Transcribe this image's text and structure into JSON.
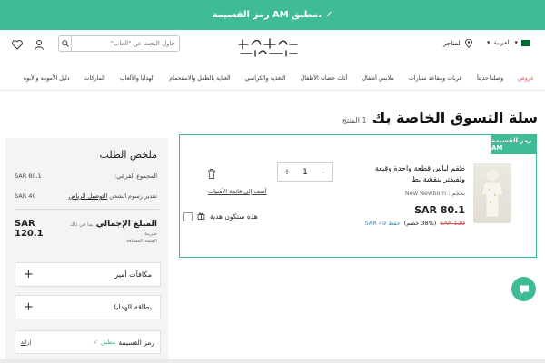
{
  "banner": {
    "text": "رمز القسيمة AM مطبق.",
    "check": "✓"
  },
  "header": {
    "search_placeholder": "حاول البحث عن \"ألعاب\"",
    "store_label": "المتاجر",
    "language_label": "العربية",
    "logo_text": "مامازوبابا"
  },
  "nav": {
    "items": [
      "عروض",
      "وصلنا حديثاً",
      "عربات ومقاعد سيارات",
      "ملابس أطفال",
      "أثاث حضانة الأطفال",
      "التغذية والكراسي",
      "العناية بالطفل والاستحمام",
      "الهدايا والألعاب",
      "الماركات",
      "دليل الأمومة والأبوة"
    ]
  },
  "page": {
    "title": "سلة التسوق الخاصة بك",
    "count": "1 المنتج"
  },
  "cart": {
    "ribbon": "رمز القسيمة AM",
    "product_title": "طقم لباس قطعة واحدة وقبعة ولفيفتر بنقشة بط",
    "size_label": "بحجم :",
    "size_value": "New Newborn",
    "price": "SAR 80.1",
    "old_price": "SAR 129",
    "discount_pct": "(38% خصم)",
    "save_text": "حفظ SAR 49",
    "quantity": "1",
    "minus": "-",
    "plus": "+",
    "wishlist_link": "أضف إلى قائمة الأمنيات",
    "gift_label": "هذه ستكون هدية"
  },
  "summary": {
    "title": "ملخص الطلب",
    "subtotal_label": "المجموع الفرعي:",
    "subtotal_value": "SAR 80.1",
    "shipping_label": "تقدير رسوم الشحن",
    "shipping_city": "التوصيل الرياض",
    "shipping_value": "SAR 40",
    "total_label": "المبلغ الإجمالي",
    "total_tax_note": "بما في ذلك ضريبة",
    "total_value": "SAR 120.1",
    "vat_note": "القيمة المضافة",
    "rewards_label": "مكافآت أمير",
    "giftcard_label": "بطاقة الهدايا",
    "coupon_label": "رمز القسيمة",
    "coupon_status": "مطبق",
    "coupon_remove": "إزالة"
  },
  "colors": {
    "accent": "#3fbc96",
    "sale": "#c55555",
    "save": "#3f8fbc"
  },
  "icons": [
    "check-icon",
    "search-icon",
    "user-icon",
    "heart-icon",
    "location-pin-icon",
    "chevron-down-icon",
    "trash-icon",
    "gift-icon",
    "plus-icon",
    "chat-icon",
    "flag-icon"
  ]
}
